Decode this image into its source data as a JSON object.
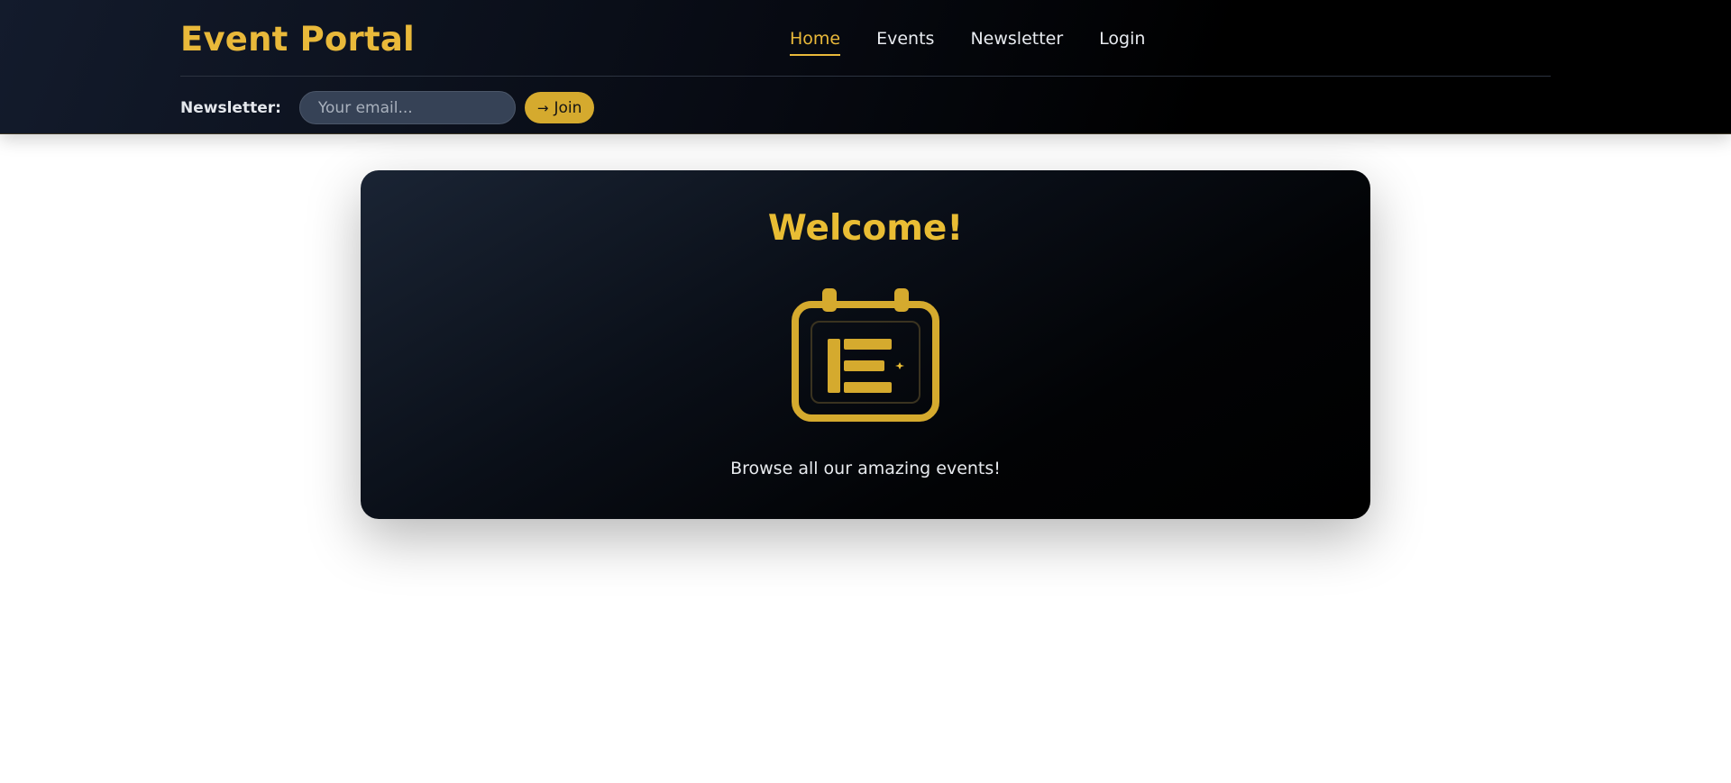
{
  "header": {
    "brand": "Event Portal",
    "nav": [
      {
        "label": "Home",
        "active": true
      },
      {
        "label": "Events",
        "active": false
      },
      {
        "label": "Newsletter",
        "active": false
      },
      {
        "label": "Login",
        "active": false
      }
    ],
    "newsletter": {
      "label": "Newsletter:",
      "placeholder": "Your email...",
      "value": "",
      "button_label": "Join",
      "button_icon": "arrow-right-icon"
    }
  },
  "hero": {
    "title": "Welcome!",
    "icon": "calendar-event-icon",
    "text": "Browse all our amazing events!"
  },
  "colors": {
    "accent": "#e9b93a",
    "button": "#d5aa2e",
    "header_bg": "#0b111c",
    "card_bg": "#0a0f18"
  }
}
